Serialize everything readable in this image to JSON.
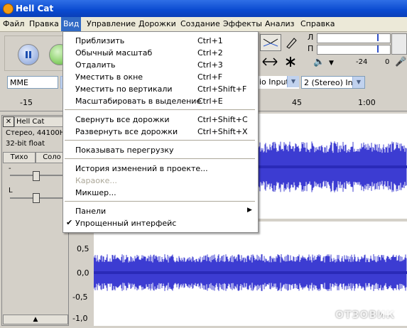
{
  "window": {
    "title": "Hell Cat"
  },
  "menubar": [
    "Файл",
    "Правка",
    "Вид",
    "Управление",
    "Дорожки",
    "Создание",
    "Эффекты",
    "Анализ",
    "Справка"
  ],
  "view_menu": {
    "items": [
      {
        "label": "Приблизить",
        "shortcut": "Ctrl+1"
      },
      {
        "label": "Обычный масштаб",
        "shortcut": "Ctrl+2"
      },
      {
        "label": "Отдалить",
        "shortcut": "Ctrl+3"
      },
      {
        "label": "Уместить в окне",
        "shortcut": "Ctrl+F"
      },
      {
        "label": "Уместить по вертикали",
        "shortcut": "Ctrl+Shift+F"
      },
      {
        "label": "Масштабировать в выделение",
        "shortcut": "Ctrl+E"
      },
      {
        "label": "Свернуть все дорожки",
        "shortcut": "Ctrl+Shift+C"
      },
      {
        "label": "Развернуть все дорожки",
        "shortcut": "Ctrl+Shift+X"
      },
      {
        "label": "Показывать перегрузку",
        "shortcut": ""
      },
      {
        "label": "История изменений в проекте...",
        "shortcut": ""
      },
      {
        "label": "Караоке...",
        "shortcut": ""
      },
      {
        "label": "Микшер...",
        "shortcut": ""
      },
      {
        "label": "Панели",
        "shortcut": ""
      },
      {
        "label": "Упрощенный интерфейс",
        "shortcut": ""
      }
    ]
  },
  "meters": {
    "left": "Л",
    "right": "П",
    "db_marks": [
      "-24",
      "0"
    ]
  },
  "devices": {
    "host": "MME",
    "input_source": "dio Input",
    "channels": "2 (Stereo) Inp"
  },
  "ruler": [
    "-15",
    "45",
    "1:00"
  ],
  "track": {
    "name": "Hell Cat",
    "info_line1": "Стерео, 44100Н",
    "info_line2": "32-bit float",
    "mute": "Тихо",
    "solo": "Соло",
    "gain_minus": "-",
    "pan_left": "L"
  },
  "vruler_labels": [
    "0,5",
    "0,0",
    "-0,5",
    "-1,0"
  ],
  "watermark": "ОТЗОВИК",
  "colors": {
    "wave": "#3c3cd2",
    "wave_dark": "#2a2ab8",
    "menu_highlight": "#316ac5",
    "titlebar": "#0a4ad0"
  }
}
